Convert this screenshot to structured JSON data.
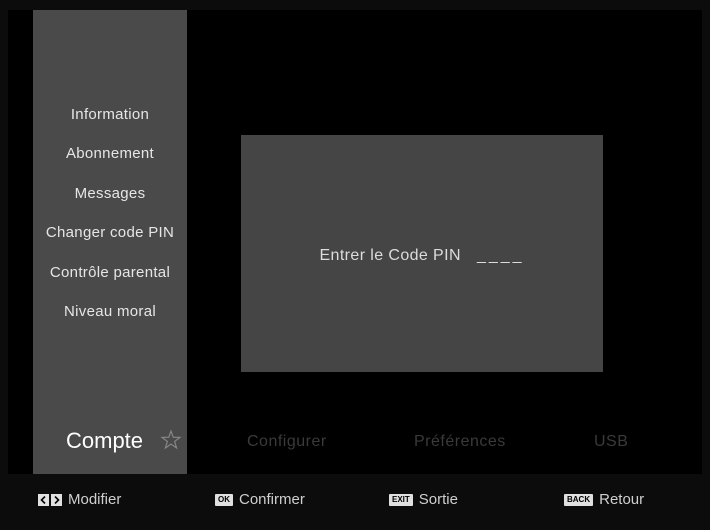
{
  "sidebar": {
    "items": [
      {
        "label": "Information"
      },
      {
        "label": "Abonnement"
      },
      {
        "label": "Messages"
      },
      {
        "label": "Changer code PIN"
      },
      {
        "label": "Contrôle parental"
      },
      {
        "label": "Niveau moral"
      }
    ]
  },
  "dialog": {
    "prompt": "Entrer le Code PIN",
    "pin_mask": "____"
  },
  "tabs": {
    "active": "Compte",
    "items": [
      "Configurer",
      "Préférences",
      "USB"
    ]
  },
  "footer": {
    "hints": [
      {
        "key": "< >",
        "label": "Modifier"
      },
      {
        "key": "OK",
        "label": "Confirmer"
      },
      {
        "key": "EXIT",
        "label": "Sortie"
      },
      {
        "key": "BACK",
        "label": "Retour"
      }
    ]
  },
  "icons": {
    "tab_active_icon": "star-icon",
    "left_arrow": "arrow-left-icon",
    "right_arrow": "arrow-right-icon"
  },
  "colors": {
    "sidebar_bg": "#4a4a4a",
    "dialog_bg": "#454545",
    "inactive_tab": "#3a3a3a"
  }
}
